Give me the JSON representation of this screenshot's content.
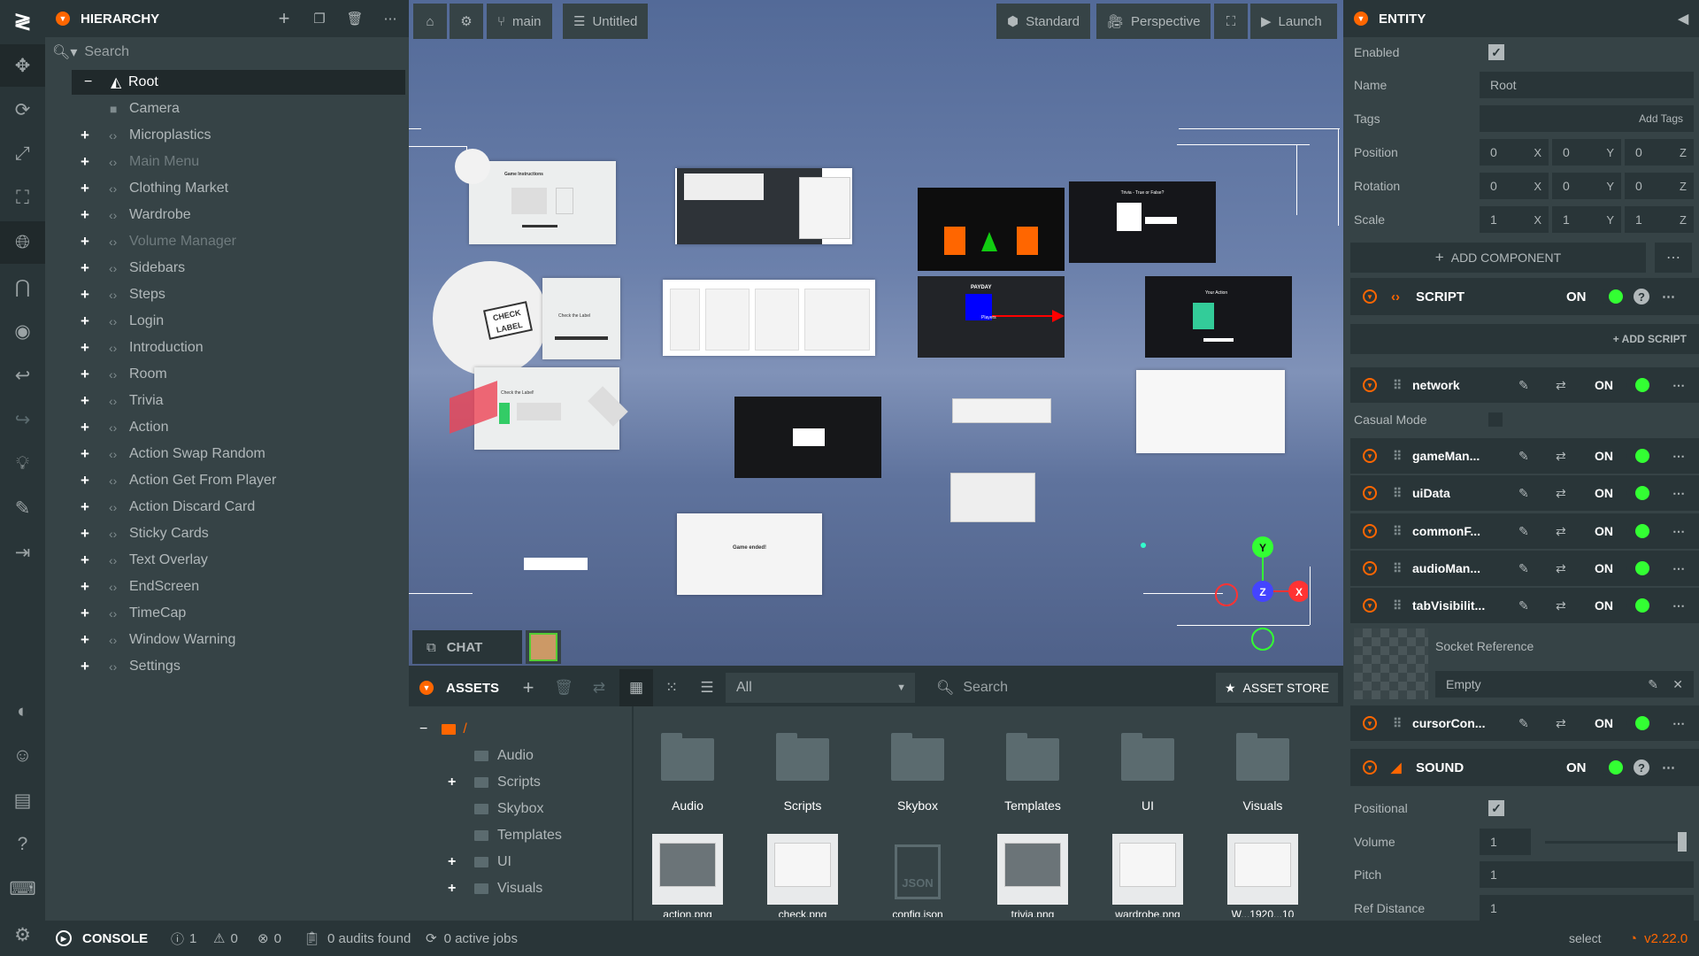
{
  "hierarchy": {
    "title": "HIERARCHY",
    "search_placeholder": "Search",
    "root_label": "Root",
    "items": [
      {
        "label": "Camera",
        "expandable": false,
        "disabled": false
      },
      {
        "label": "Microplastics",
        "expandable": true,
        "disabled": false
      },
      {
        "label": "Main Menu",
        "expandable": true,
        "disabled": true
      },
      {
        "label": "Clothing Market",
        "expandable": true,
        "disabled": false
      },
      {
        "label": "Wardrobe",
        "expandable": true,
        "disabled": false
      },
      {
        "label": "Volume Manager",
        "expandable": true,
        "disabled": true
      },
      {
        "label": "Sidebars",
        "expandable": true,
        "disabled": false
      },
      {
        "label": "Steps",
        "expandable": true,
        "disabled": false
      },
      {
        "label": "Login",
        "expandable": true,
        "disabled": false
      },
      {
        "label": "Introduction",
        "expandable": true,
        "disabled": false
      },
      {
        "label": "Room",
        "expandable": true,
        "disabled": false
      },
      {
        "label": "Trivia",
        "expandable": true,
        "disabled": false
      },
      {
        "label": "Action",
        "expandable": true,
        "disabled": false
      },
      {
        "label": "Action Swap Random",
        "expandable": true,
        "disabled": false
      },
      {
        "label": "Action Get From Player",
        "expandable": true,
        "disabled": false
      },
      {
        "label": "Action Discard Card",
        "expandable": true,
        "disabled": false
      },
      {
        "label": "Sticky Cards",
        "expandable": true,
        "disabled": false
      },
      {
        "label": "Text Overlay",
        "expandable": true,
        "disabled": false
      },
      {
        "label": "EndScreen",
        "expandable": true,
        "disabled": false
      },
      {
        "label": "TimeCap",
        "expandable": true,
        "disabled": false
      },
      {
        "label": "Window Warning",
        "expandable": true,
        "disabled": false
      },
      {
        "label": "Settings",
        "expandable": true,
        "disabled": false
      }
    ]
  },
  "viewport": {
    "branch": "main",
    "scene": "Untitled",
    "render_mode": "Standard",
    "camera": "Perspective",
    "launch": "Launch",
    "gizmo": {
      "y": "Y",
      "z": "Z",
      "x": "X"
    },
    "card_texts": {
      "instructions": "Game Instructions",
      "check_label": "CHECK LABEL",
      "check_label_title": "Check the Label",
      "check_label_title2": "Check the Label!",
      "payday": "PAYDAY",
      "players": "Players",
      "trivia": "Trivia - True or False?",
      "your_action": "Your Action",
      "game_ended": "Game ended!"
    }
  },
  "chat": {
    "label": "CHAT"
  },
  "assets": {
    "title": "ASSETS",
    "filter": "All",
    "search_placeholder": "Search",
    "store": "ASSET STORE",
    "root": "/",
    "tree": [
      {
        "label": "Audio",
        "expandable": false
      },
      {
        "label": "Scripts",
        "expandable": true
      },
      {
        "label": "Skybox",
        "expandable": false
      },
      {
        "label": "Templates",
        "expandable": false
      },
      {
        "label": "UI",
        "expandable": true
      },
      {
        "label": "Visuals",
        "expandable": true
      }
    ],
    "folders": [
      "Audio",
      "Scripts",
      "Skybox",
      "Templates",
      "UI",
      "Visuals"
    ],
    "files": [
      "action.png",
      "check.png",
      "config.json",
      "trivia.png",
      "wardrobe.png",
      "W...1920...10"
    ]
  },
  "entity": {
    "title": "ENTITY",
    "enabled_label": "Enabled",
    "name_label": "Name",
    "name_value": "Root",
    "tags_label": "Tags",
    "tags_placeholder": "Add Tags",
    "position_label": "Position",
    "rotation_label": "Rotation",
    "scale_label": "Scale",
    "position": [
      "0",
      "0",
      "0"
    ],
    "rotation": [
      "0",
      "0",
      "0"
    ],
    "scale": [
      "1",
      "1",
      "1"
    ],
    "axes": [
      "X",
      "Y",
      "Z"
    ],
    "add_component": "ADD COMPONENT",
    "script_title": "SCRIPT",
    "on_label": "ON",
    "add_script": "+ ADD SCRIPT",
    "casual_mode": "Casual Mode",
    "scripts": [
      "network",
      "gameMan...",
      "uiData",
      "commonF...",
      "audioMan...",
      "tabVisibilit..."
    ],
    "socket_reference": "Socket Reference",
    "socket_value": "Empty",
    "cursor_script": "cursorCon...",
    "sound_title": "SOUND",
    "positional_label": "Positional",
    "volume_label": "Volume",
    "volume_value": "1",
    "volume_level": 1.0,
    "pitch_label": "Pitch",
    "pitch_value": "1",
    "ref_distance_label": "Ref Distance",
    "ref_distance_value": "1"
  },
  "console": {
    "label": "CONSOLE",
    "info_count": "1",
    "warn_count": "0",
    "error_count": "0",
    "audits": "0 audits found",
    "jobs": "0 active jobs",
    "mode": "select",
    "version": "v2.22.0"
  },
  "colors": {
    "accent": "#ff6600",
    "panel": "#364346",
    "bar": "#293538",
    "toggle_on": "#33ff33"
  }
}
